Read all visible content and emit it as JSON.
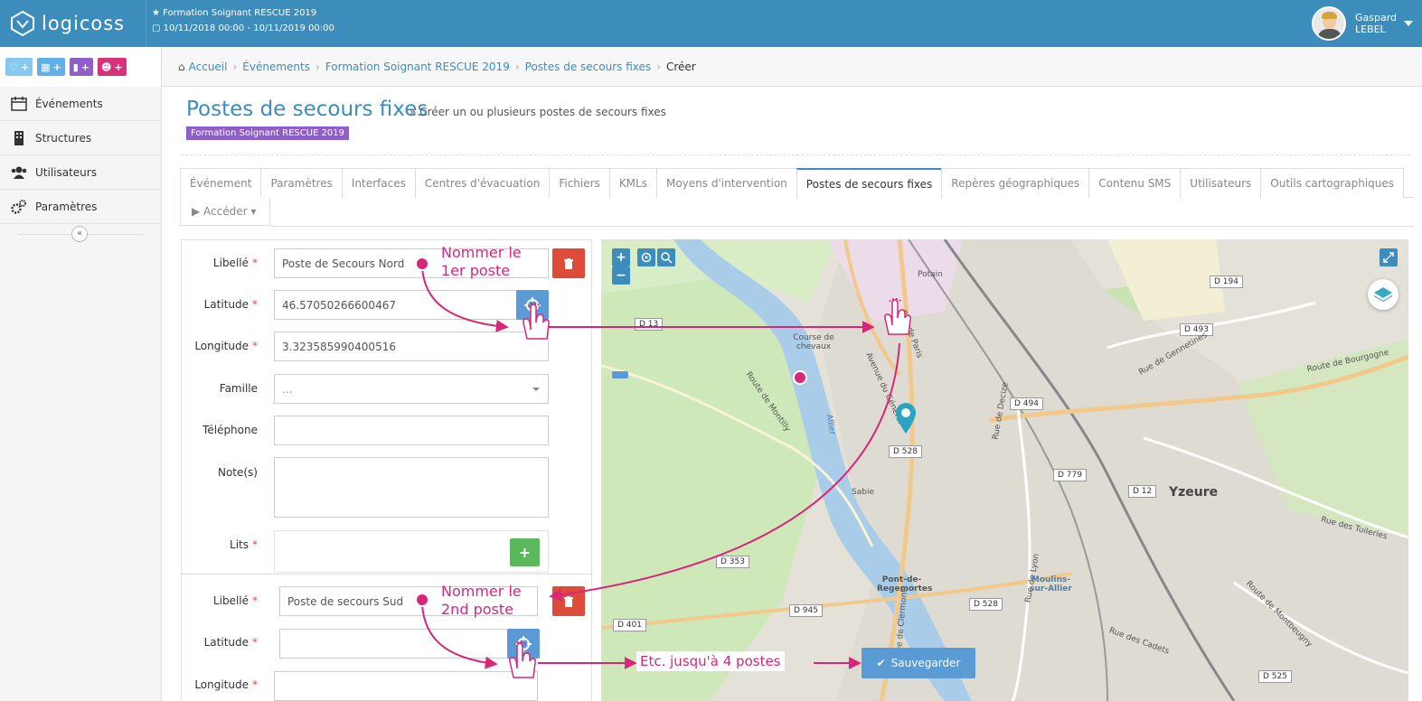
{
  "brand": {
    "name": "logicoss"
  },
  "event": {
    "title": "★ Formation Soignant RESCUE 2019",
    "dates": "10/11/2018 00:00 - 10/11/2019 00:00"
  },
  "user": {
    "first_name": "Gaspard",
    "last_name": "LEBEL"
  },
  "quick_actions": [
    {
      "label": "+",
      "icon": "heartbeat-icon"
    },
    {
      "label": "+",
      "icon": "calendar-icon"
    },
    {
      "label": "+",
      "icon": "building-icon"
    },
    {
      "label": "+",
      "icon": "users-icon"
    }
  ],
  "breadcrumb": [
    {
      "label": "Accueil"
    },
    {
      "label": "Événements"
    },
    {
      "label": "Formation Soignant RESCUE 2019"
    },
    {
      "label": "Postes de secours fixes"
    },
    {
      "label": "Créer"
    }
  ],
  "sidebar": {
    "items": [
      {
        "label": "Événements",
        "icon": "calendar-icon"
      },
      {
        "label": "Structures",
        "icon": "building-icon"
      },
      {
        "label": "Utilisateurs",
        "icon": "users-icon"
      },
      {
        "label": "Paramètres",
        "icon": "gears-icon"
      }
    ],
    "collapse_label": "«"
  },
  "page": {
    "title": "Postes de secours fixes",
    "subtitle": "» Créer un ou plusieurs postes de secours fixes",
    "badge": "Formation Soignant RESCUE 2019"
  },
  "tabs": [
    {
      "label": "Événement",
      "active": false
    },
    {
      "label": "Paramètres",
      "active": false
    },
    {
      "label": "Interfaces",
      "active": false
    },
    {
      "label": "Centres d'évacuation",
      "active": false
    },
    {
      "label": "Fichiers",
      "active": false
    },
    {
      "label": "KMLs",
      "active": false
    },
    {
      "label": "Moyens d'intervention",
      "active": false
    },
    {
      "label": "Postes de secours fixes",
      "active": true
    },
    {
      "label": "Repères géographiques",
      "active": false
    },
    {
      "label": "Contenu SMS",
      "active": false
    },
    {
      "label": "Utilisateurs",
      "active": false
    },
    {
      "label": "Outils cartographiques",
      "active": false
    }
  ],
  "access_tab": "▶ Accéder ▾",
  "form": {
    "labels": {
      "libelle": "Libellé",
      "latitude": "Latitude",
      "longitude": "Longitude",
      "famille": "Famille",
      "telephone": "Téléphone",
      "notes": "Note(s)",
      "lits": "Lits",
      "required_mark": "*"
    },
    "post1": {
      "libelle": "Poste de Secours Nord",
      "latitude": "46.57050266600467",
      "longitude": "3.323585990400516",
      "famille": "...",
      "telephone": "",
      "notes": ""
    },
    "post2": {
      "libelle": "Poste de secours Sud",
      "latitude": "",
      "longitude": ""
    },
    "add_label": "+"
  },
  "map": {
    "zoom_in": "+",
    "zoom_out": "−",
    "road_labels": [
      "D 194",
      "D 493",
      "D 13",
      "D 494",
      "D 528",
      "D 779",
      "D 12",
      "D 353",
      "D 945",
      "D 401",
      "D 525",
      "D 528"
    ],
    "street_labels": [
      "Potain",
      "Course de chevaux",
      "Route de Montilly",
      "Rue de Paris",
      "Rue de Decize",
      "Route de Bourgogne",
      "Rue des Tuileries",
      "Rue de Gennetines",
      "Rue de Lyon",
      "Rue des Cadets",
      "Route de Montbeugny",
      "Rue de Clermont",
      "Sabie",
      "Allier",
      "Avenue du Général"
    ],
    "places": [
      "Pont-de-Regemortes",
      "Moulins-sur-Allier"
    ],
    "city": "Yzeure",
    "save_label": "Sauvegarder"
  },
  "annotations": {
    "name_first": "Nommer le 1er poste",
    "name_first_l1": "Nommer le",
    "name_first_l2": "1er poste",
    "name_second_l1": "Nommer le",
    "name_second_l2": "2nd poste",
    "etc": "Etc. jusqu'à 4 postes"
  },
  "colors": {
    "header": "#3c8dbc",
    "accent": "#d6277a",
    "badge": "#8e5fc8",
    "danger": "#dd4b39",
    "success": "#5cb85c",
    "locate": "#5b9bd5"
  }
}
